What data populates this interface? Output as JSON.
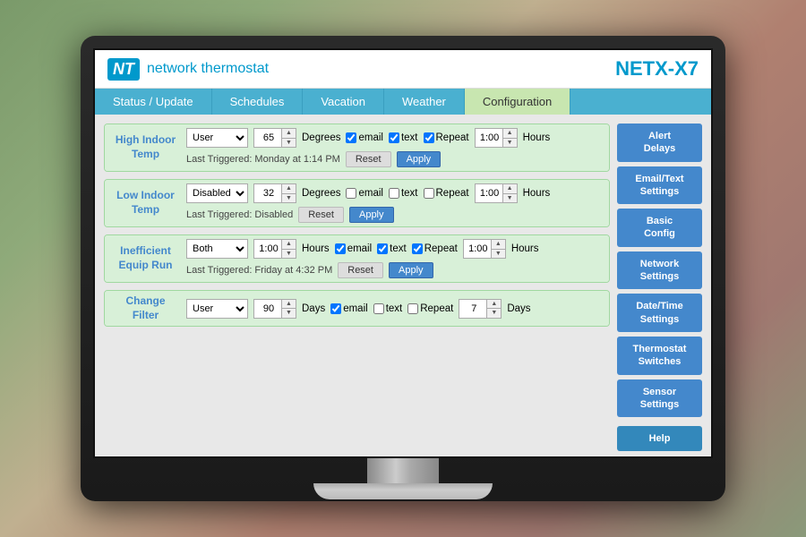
{
  "monitor": {
    "logo_icon": "NT",
    "logo_text": "network thermostat",
    "app_title": "NETX-X7"
  },
  "nav": {
    "tabs": [
      {
        "label": "Status / Update",
        "active": false
      },
      {
        "label": "Schedules",
        "active": false
      },
      {
        "label": "Vacation",
        "active": false
      },
      {
        "label": "Weather",
        "active": false
      },
      {
        "label": "Configuration",
        "active": true
      }
    ]
  },
  "alerts": [
    {
      "title": "High Indoor\nTemp",
      "select_value": "User",
      "select_options": [
        "User",
        "Disabled",
        "Both"
      ],
      "temp_value": "65",
      "temp_unit": "Degrees",
      "email_checked": true,
      "text_checked": true,
      "repeat_checked": true,
      "time_value": "1:00",
      "time_unit": "Hours",
      "last_triggered": "Last Triggered:  Monday at 1:14 PM",
      "reset_label": "Reset",
      "apply_label": "Apply"
    },
    {
      "title": "Low Indoor\nTemp",
      "select_value": "Disabled",
      "select_options": [
        "User",
        "Disabled",
        "Both"
      ],
      "temp_value": "32",
      "temp_unit": "Degrees",
      "email_checked": false,
      "text_checked": false,
      "repeat_checked": false,
      "time_value": "1:00",
      "time_unit": "Hours",
      "last_triggered": "Last Triggered:  Disabled",
      "reset_label": "Reset",
      "apply_label": "Apply"
    },
    {
      "title": "Inefficient\nEquip Run",
      "select_value": "Both",
      "select_options": [
        "User",
        "Disabled",
        "Both"
      ],
      "temp_value": "1:00",
      "temp_unit": "Hours",
      "email_checked": true,
      "text_checked": true,
      "repeat_checked": true,
      "time_value": "1:00",
      "time_unit": "Hours",
      "last_triggered": "Last Triggered:  Friday at 4:32 PM",
      "reset_label": "Reset",
      "apply_label": "Apply"
    },
    {
      "title": "Change\nFilter",
      "select_value": "User",
      "select_options": [
        "User",
        "Disabled",
        "Both"
      ],
      "temp_value": "90",
      "temp_unit": "Days",
      "email_checked": true,
      "text_checked": false,
      "repeat_checked": false,
      "time_value": "7",
      "time_unit": "Days",
      "last_triggered": null,
      "reset_label": "Reset",
      "apply_label": "Apply"
    }
  ],
  "sidebar": {
    "buttons": [
      {
        "label": "Alert\nDelays"
      },
      {
        "label": "Email/Text\nSettings"
      },
      {
        "label": "Basic\nConfig"
      },
      {
        "label": "Network\nSettings"
      },
      {
        "label": "Date/Time\nSettings"
      },
      {
        "label": "Thermostat\nSwitches"
      },
      {
        "label": "Sensor\nSettings"
      }
    ],
    "help_label": "Help"
  }
}
